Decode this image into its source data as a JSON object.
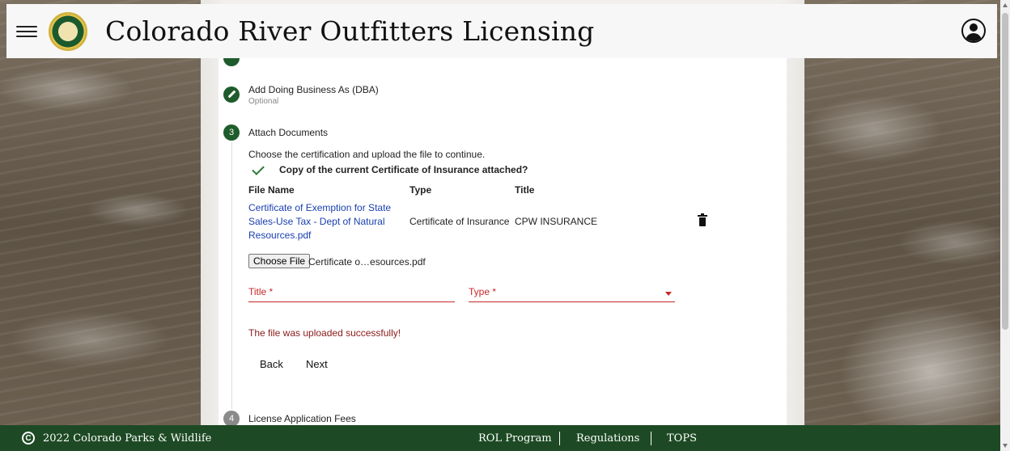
{
  "app": {
    "title": "Colorado River Outfitters Licensing"
  },
  "steps": {
    "dba": {
      "title": "Add Doing Business As (DBA)",
      "subtitle": "Optional"
    },
    "attach": {
      "number": "3",
      "title": "Attach Documents",
      "instruction": "Choose the certification and upload the file to continue.",
      "requirement": "Copy of the current Certificate of Insurance attached?",
      "table": {
        "headers": [
          "File Name",
          "Type",
          "Title"
        ],
        "rows": [
          {
            "file_name_lines": [
              "Certificate of Exemption for State",
              "Sales-Use Tax - Dept of Natural",
              "Resources.pdf"
            ],
            "type": "Certificate of Insurance",
            "title": "CPW INSURANCE"
          }
        ]
      },
      "file_input": {
        "button_label": "Choose File",
        "selected_file": "Certificate o…esources.pdf"
      },
      "title_field": {
        "label": "Title *"
      },
      "type_field": {
        "label": "Type *"
      },
      "success_message": "The file was uploaded successfully!",
      "back_label": "Back",
      "next_label": "Next"
    },
    "fees": {
      "number": "4",
      "title": "License Application Fees"
    }
  },
  "footer": {
    "copyright": "2022 Colorado Parks & Wildlife",
    "links": [
      "ROL Program",
      "Regulations",
      "TOPS"
    ]
  },
  "colors": {
    "primary_green": "#1f5c2c",
    "footer_green": "#1d4a24",
    "error_red": "#c62828",
    "link_blue": "#1a3fb0"
  },
  "icons": [
    "menu-icon",
    "cpw-logo",
    "account-icon",
    "pencil-icon",
    "check-icon",
    "trash-icon",
    "copyright-icon"
  ]
}
